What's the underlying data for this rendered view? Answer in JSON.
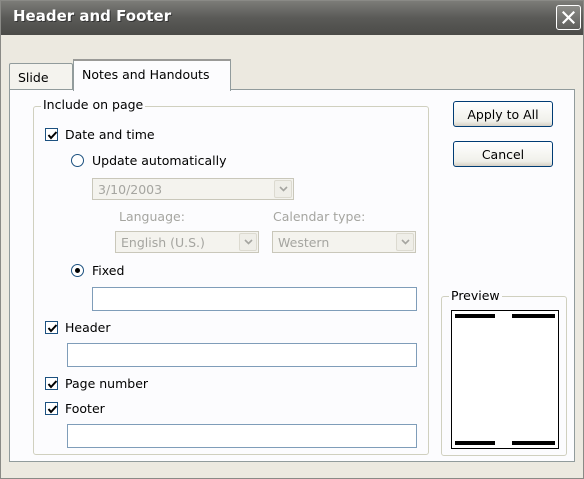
{
  "dialog": {
    "title": "Header and Footer"
  },
  "tabs": [
    {
      "label": "Slide",
      "active": false
    },
    {
      "label": "Notes and Handouts",
      "active": true
    }
  ],
  "include_group": {
    "legend": "Include on page",
    "date_and_time": {
      "label": "Date and time",
      "checked": true
    },
    "update_automatically": {
      "label": "Update automatically",
      "selected": false
    },
    "date_combo": {
      "value": "3/10/2003",
      "disabled": true
    },
    "language": {
      "label": "Language:",
      "value": "English (U.S.)",
      "disabled": true
    },
    "calendar_type": {
      "label": "Calendar type:",
      "value": "Western",
      "disabled": true
    },
    "fixed": {
      "label": "Fixed",
      "selected": true,
      "value": ""
    },
    "header": {
      "label": "Header",
      "checked": true,
      "value": ""
    },
    "page_number": {
      "label": "Page number",
      "checked": true
    },
    "footer": {
      "label": "Footer",
      "checked": true,
      "value": ""
    }
  },
  "buttons": {
    "apply_to_all": "Apply to All",
    "cancel": "Cancel"
  },
  "preview": {
    "legend": "Preview"
  },
  "colors": {
    "titlebar": "#5a5a57",
    "dialog_bg": "#ece9e0",
    "panel_bg": "#fcfcfe",
    "disabled_text": "#a5a5a0"
  },
  "icons": {
    "close": "close-icon",
    "check": "checkmark-icon",
    "dropdown": "chevron-down-icon"
  }
}
